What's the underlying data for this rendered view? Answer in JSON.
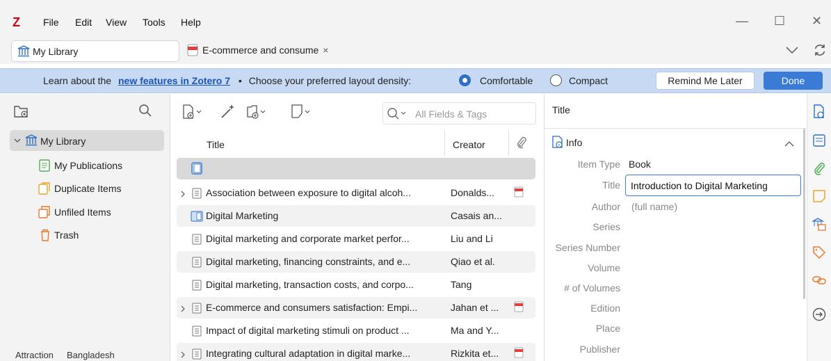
{
  "app": {
    "logo": "Z",
    "menu": [
      "File",
      "Edit",
      "View",
      "Tools",
      "Help"
    ],
    "window_controls": [
      "—",
      "☐",
      "✕"
    ]
  },
  "tabs": {
    "library": "My Library",
    "document": "E-commerce and consume",
    "close": "×"
  },
  "banner": {
    "prefix": "Learn about the",
    "link": "new features in Zotero 7",
    "bullet": "•",
    "density_prompt": "Choose your preferred layout density:",
    "opt_comfortable": "Comfortable",
    "opt_compact": "Compact",
    "remind": "Remind Me Later",
    "done": "Done"
  },
  "collections": {
    "root": "My Library",
    "items": [
      "My Publications",
      "Duplicate Items",
      "Unfiled Items",
      "Trash"
    ]
  },
  "tags": [
    "Attraction",
    "Bangladesh"
  ],
  "items_pane": {
    "search_placeholder": "All Fields & Tags",
    "col_title": "Title",
    "col_creator": "Creator",
    "rows": [
      {
        "title": "",
        "creator": "",
        "type": "book-new",
        "expand": false,
        "pdf": false
      },
      {
        "title": "Association between exposure to digital alcoh...",
        "creator": "Donalds...",
        "type": "article",
        "expand": true,
        "pdf": true
      },
      {
        "title": "Digital Marketing",
        "creator": "Casais an...",
        "type": "book",
        "expand": false,
        "pdf": false
      },
      {
        "title": "Digital marketing and corporate market perfor...",
        "creator": "Liu and Li",
        "type": "article",
        "expand": false,
        "pdf": false
      },
      {
        "title": "Digital marketing, financing constraints, and e...",
        "creator": "Qiao et al.",
        "type": "article",
        "expand": false,
        "pdf": false
      },
      {
        "title": "Digital marketing, transaction costs, and corpo...",
        "creator": "Tang",
        "type": "article",
        "expand": false,
        "pdf": false
      },
      {
        "title": "E-commerce and consumers satisfaction: Empi...",
        "creator": "Jahan et ...",
        "type": "article",
        "expand": true,
        "pdf": true
      },
      {
        "title": "Impact of digital marketing stimuli on product ...",
        "creator": "Ma and Y...",
        "type": "article",
        "expand": false,
        "pdf": false
      },
      {
        "title": "Integrating cultural adaptation in digital marke...",
        "creator": "Rizkita et...",
        "type": "article",
        "expand": true,
        "pdf": true
      }
    ]
  },
  "item_pane": {
    "header": "Title",
    "section": "Info",
    "fields": {
      "item_type_label": "Item Type",
      "item_type_value": "Book",
      "title_label": "Title",
      "title_value": "Introduction to Digital Marketing",
      "author_label": "Author",
      "author_value": "(full name)",
      "series": "Series",
      "series_number": "Series Number",
      "volume": "Volume",
      "num_volumes": "# of Volumes",
      "edition": "Edition",
      "place": "Place",
      "publisher": "Publisher"
    }
  },
  "colors": {
    "accent": "#3a7bd5",
    "banner_bg": "#c7d9f3",
    "logo_red": "#d0021b",
    "sidebar_orange": "#e8792b",
    "sidebar_green": "#4caf50",
    "sidebar_blue": "#2d6fc4"
  }
}
